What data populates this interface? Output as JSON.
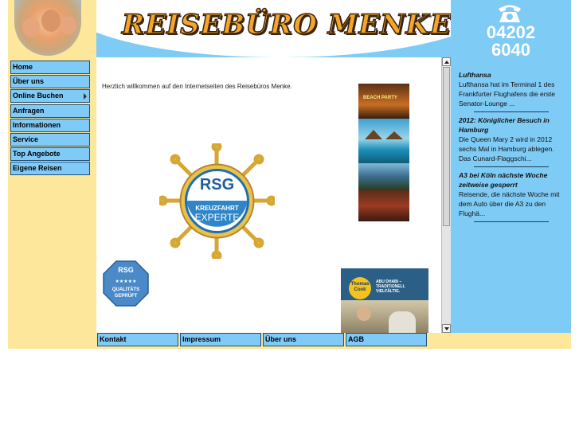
{
  "header": {
    "logo_text": "REISEBÜRO MENKE"
  },
  "phone": {
    "line1": "04202",
    "line2": "6040"
  },
  "nav": {
    "items": [
      {
        "label": "Home"
      },
      {
        "label": "Über uns"
      },
      {
        "label": "Online Buchen",
        "has_submenu": true
      },
      {
        "label": "Anfragen"
      },
      {
        "label": "Informationen"
      },
      {
        "label": "Service"
      },
      {
        "label": "Top Angebote"
      },
      {
        "label": "Eigene Reisen"
      }
    ]
  },
  "main": {
    "welcome": "Herzlich willkommen auf den Internetseiten des Reisebüros Menke."
  },
  "badges": {
    "rsg_wheel": {
      "brand": "RSG",
      "line1": "KREUZFAHRT",
      "line2": "EXPERTE"
    },
    "rsg_seal": {
      "brand": "RSG",
      "stars": "★★★★★",
      "line1": "QUALITÄTS",
      "line2": "GEPRÜFT"
    },
    "beach_party": "BEACH PARTY",
    "thomas_cook": {
      "brand_line1": "Thomas",
      "brand_line2": "Cook",
      "text_line1": "ABU DHABI –",
      "text_line2": "TRADITIONELL",
      "text_line3": "VIELFÄLTIG."
    }
  },
  "news": [
    {
      "title": "Lufthansa",
      "text": "Lufthansa hat im Terminal 1 des Frankfurter Flughafens die erste Senator-Lounge ..."
    },
    {
      "title": "2012: Königlicher Besuch in Hamburg",
      "text": "Die Queen Mary 2 wird in 2012 sechs Mal in Hamburg ablegen. Das Cunard-Flaggschi..."
    },
    {
      "title": "A3 bei Köln nächste Woche zeitweise gesperrt",
      "text": "Reisende, die nächste Woche mit dem Auto über die A3 zu den Flughä..."
    }
  ],
  "footer": {
    "links": [
      {
        "label": "Kontakt"
      },
      {
        "label": "Impressum"
      },
      {
        "label": "Über uns"
      },
      {
        "label": "AGB"
      }
    ]
  },
  "colors": {
    "sky_blue": "#7ecbf6",
    "sand_yellow": "#fde79a",
    "nav_blue": "#7fcaf7",
    "logo_orange": "#f4a62a"
  }
}
